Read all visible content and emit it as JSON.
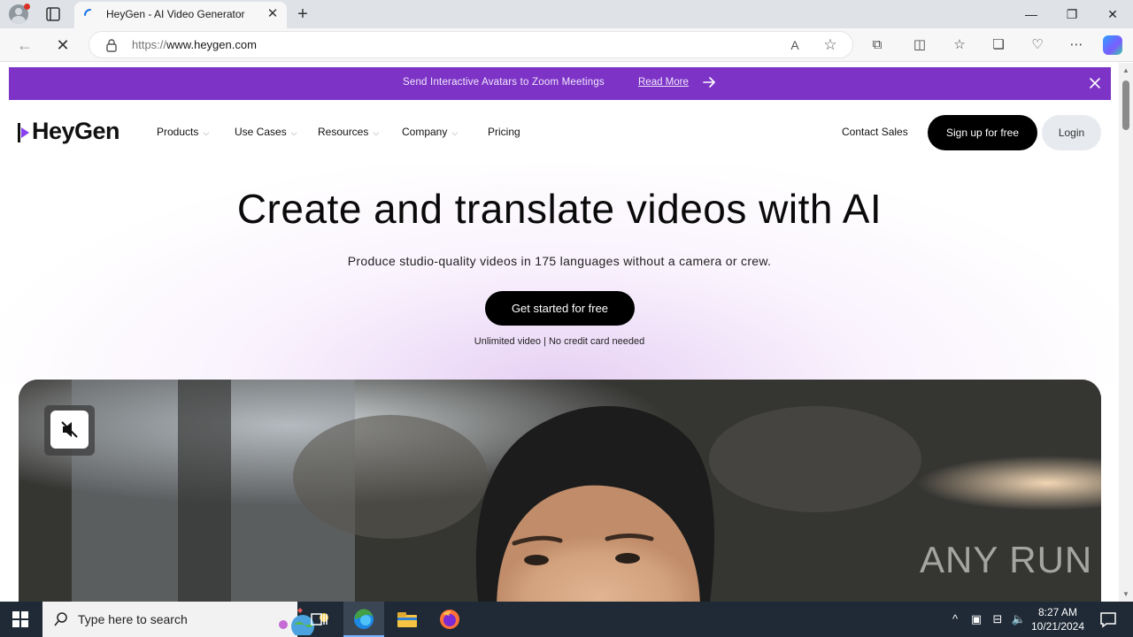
{
  "browser": {
    "tab_title": "HeyGen - AI Video Generator",
    "url_scheme": "https://",
    "url_host": "www.heygen.com"
  },
  "banner": {
    "text": "Send Interactive Avatars to Zoom Meetings",
    "link": "Read More"
  },
  "header": {
    "logo": "HeyGen",
    "nav": [
      {
        "label": "Products"
      },
      {
        "label": "Use Cases"
      },
      {
        "label": "Resources"
      },
      {
        "label": "Company"
      },
      {
        "label": "Pricing"
      }
    ],
    "contact": "Contact Sales",
    "signup": "Sign up for free",
    "login": "Login"
  },
  "hero": {
    "title": "Create and translate videos with AI",
    "subtitle": "Produce studio-quality videos in 175 languages without a camera or crew.",
    "cta": "Get started for free",
    "note": "Unlimited video | No credit card needed"
  },
  "video": {
    "watermark": "ANY RUN"
  },
  "taskbar": {
    "search_placeholder": "Type here to search",
    "time": "8:27 AM",
    "date": "10/21/2024"
  },
  "colors": {
    "banner": "#7d34c6",
    "button_dark": "#000000",
    "login_bg": "#e7eaef",
    "taskbar": "#1f2a36"
  }
}
